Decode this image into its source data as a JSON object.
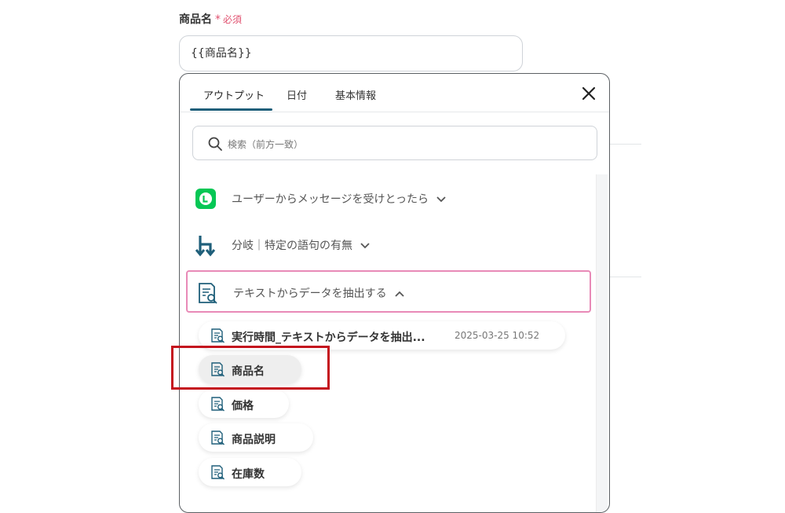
{
  "field": {
    "label": "商品名",
    "required_star": "*",
    "required_text": "必須",
    "value": "{{商品名}}"
  },
  "tabs": [
    "アウトプット",
    "日付",
    "基本情報"
  ],
  "active_tab": "アウトプット",
  "search": {
    "placeholder": "検索（前方一致）"
  },
  "sections": [
    {
      "label": "ユーザーからメッセージを受けとったら",
      "icon": "line-app-icon",
      "expanded": false
    },
    {
      "label": "分岐｜特定の語句の有無",
      "icon": "branch-icon",
      "expanded": false
    },
    {
      "label": "テキストからデータを抽出する",
      "icon": "document-search-icon",
      "expanded": true
    }
  ],
  "items": [
    {
      "label": "実行時間_テキストからデータを抽出...",
      "time": "2025-03-25 10:52"
    },
    {
      "label": "商品名"
    },
    {
      "label": "価格"
    },
    {
      "label": "商品説明"
    },
    {
      "label": "在庫数"
    }
  ],
  "colors": {
    "required": "#e0516f",
    "tab_accent": "#1f5f7a",
    "line_green": "#06c755",
    "selected_border": "#e88ab7",
    "highlight_box": "#c4121e"
  }
}
